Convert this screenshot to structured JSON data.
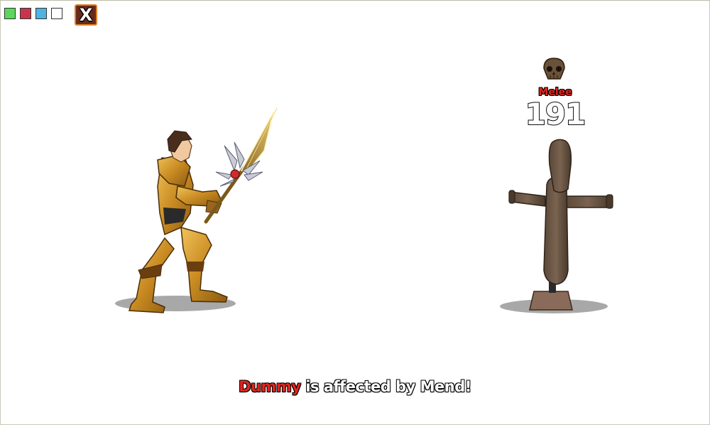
{
  "toolbar": {
    "swatches": [
      {
        "name": "green",
        "color": "#5cd65c"
      },
      {
        "name": "red",
        "color": "#c8354a"
      },
      {
        "name": "blue",
        "color": "#4fb3e3"
      },
      {
        "name": "white",
        "color": "#ffffff"
      }
    ],
    "close_label": "X"
  },
  "combat": {
    "attack_type": "Melee",
    "damage": "191",
    "message": {
      "target": "Dummy",
      "text": " is affected by Mend!"
    }
  },
  "colors": {
    "accent_red": "#e0261f",
    "close_bg": "#6a2a1a",
    "close_border": "#d9822b"
  }
}
